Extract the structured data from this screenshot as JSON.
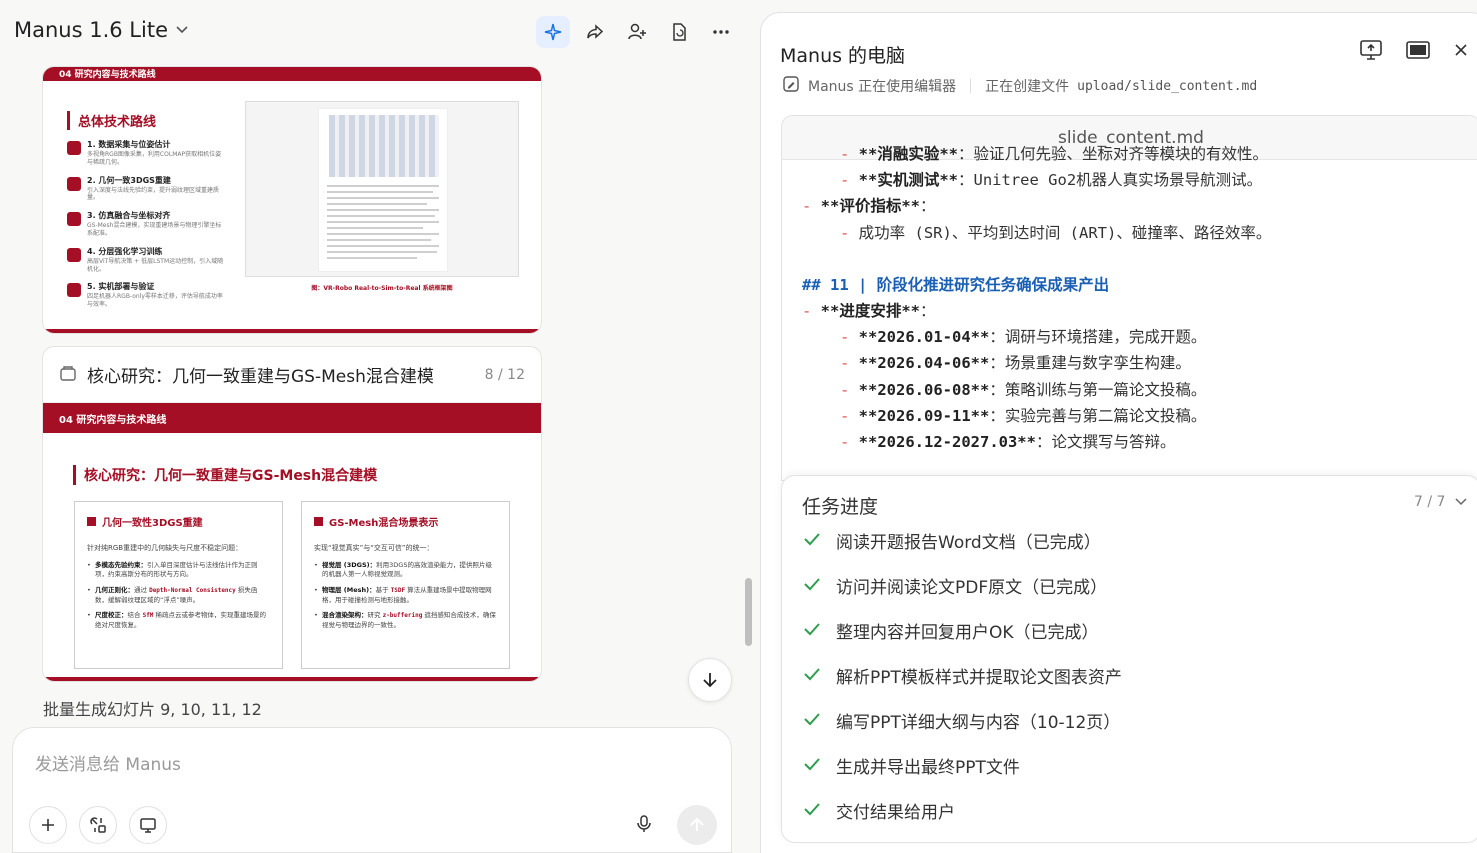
{
  "header": {
    "model_name": "Manus 1.6 Lite"
  },
  "slide_prev": {
    "section_label": "04 研究内容与技术路线",
    "title": "总体技术路线",
    "steps": [
      {
        "name": "1. 数据采集与位姿估计",
        "desc": "多视角RGB图像采集，利用COLMAP获取相机位姿与稀疏几何。"
      },
      {
        "name": "2. 几何一致3DGS重建",
        "desc": "引入深度与法线先验约束，提升弱纹理区域重建质量。"
      },
      {
        "name": "3. 仿真融合与坐标对齐",
        "desc": "GS-Mesh混合建模，实现重建场景与物理引擎坐标系配准。"
      },
      {
        "name": "4. 分层强化学习训练",
        "desc": "高层ViT导航决策 + 低层LSTM运动控制，引入域随机化。"
      },
      {
        "name": "5. 实机部署与验证",
        "desc": "四足机器人RGB-only零样本迁移，评估导航成功率与效率。"
      }
    ],
    "figure_caption": "图：VR-Robo Real-to-Sim-to-Real 系统框架图"
  },
  "slide_card": {
    "title": "核心研究：几何一致重建与GS-Mesh混合建模",
    "page": "8 / 12",
    "section_label": "04 研究内容与技术路线",
    "heading": "核心研究：几何一致重建与GS-Mesh混合建模",
    "box1": {
      "title": "几何一致性3DGS重建",
      "intro": "针对纯RGB重建中的几何缺失与尺度不稳定问题：",
      "items": [
        {
          "bold": "多模态先验约束：",
          "text": "引入单目深度估计与法线估计作为正则项，约束高斯分布的形状与方向。"
        },
        {
          "bold": "几何正则化：",
          "text": "通过 Depth-Normal Consistency 损失函数，缓解弱纹理区域的“浮点”噪声。"
        },
        {
          "bold": "尺度校正：",
          "text": "结合 SfM 稀疏点云或参考物体，实现重建场景的绝对尺度恢复。"
        }
      ]
    },
    "box2": {
      "title": "GS-Mesh混合场景表示",
      "intro": "实现“视觉真实”与“交互可信”的统一：",
      "items": [
        {
          "bold": "视觉层 (3DGS)：",
          "text": "利用3DGS的高效渲染能力，提供照片级的机器人第一人称视觉观测。"
        },
        {
          "bold": "物理层 (Mesh)：",
          "text": "基于 TSDF 算法从重建场景中提取物理网格，用于碰撞检测与地形接触。"
        },
        {
          "bold": "混合渲染架构：",
          "text": "研究 z-buffering 遮挡感知合成技术，确保视觉与物理边界的一致性。"
        }
      ]
    }
  },
  "batch_status": "批量生成幻灯片 9, 10, 11, 12",
  "composer": {
    "placeholder": "发送消息给 Manus"
  },
  "computer": {
    "title": "Manus 的电脑",
    "tool_status": "Manus 正在使用编辑器",
    "action": "正在创建文件",
    "file_path": "upload/slide_content.md"
  },
  "editor": {
    "filename": "slide_content.md",
    "lines": [
      {
        "indent": 2,
        "bold": "**消融实验**",
        "text": "：验证几何先验、坐标对齐等模块的有效性。"
      },
      {
        "indent": 2,
        "bold": "**实机测试**",
        "text": "：Unitree Go2机器人真实场景导航测试。"
      },
      {
        "indent": 1,
        "bold": "**评价指标**",
        "text": "："
      },
      {
        "indent": 2,
        "bold": "",
        "text": "成功率 (SR)、平均到达时间 (ART)、碰撞率、路径效率。"
      },
      {
        "indent": 0,
        "heading": "## 11 | 阶段化推进研究任务确保成果产出"
      },
      {
        "indent": 1,
        "bold": "**进度安排**",
        "text": "："
      },
      {
        "indent": 2,
        "bold": "**2026.01-04**",
        "text": "：调研与环境搭建，完成开题。"
      },
      {
        "indent": 2,
        "bold": "**2026.04-06**",
        "text": "：场景重建与数字孪生构建。"
      },
      {
        "indent": 2,
        "bold": "**2026.06-08**",
        "text": "：策略训练与第一篇论文投稿。"
      },
      {
        "indent": 2,
        "bold": "**2026.09-11**",
        "text": "：实验完善与第二篇论文投稿。"
      },
      {
        "indent": 2,
        "bold": "**2026.12-2027.03**",
        "text": "：论文撰写与答辩。"
      }
    ]
  },
  "tasks": {
    "title": "任务进度",
    "count": "7 / 7",
    "items": [
      "阅读开题报告Word文档（已完成）",
      "访问并阅读论文PDF原文（已完成）",
      "整理内容并回复用户OK（已完成）",
      "解析PPT模板样式并提取论文图表资产",
      "编写PPT详细大纲与内容（10-12页）",
      "生成并导出最终PPT文件",
      "交付结果给用户"
    ]
  },
  "colors": {
    "accent_red": "#a50f25",
    "check_green": "#2e9d4f",
    "heading_blue": "#1a5fb4",
    "active_icon_bg": "#e6efff"
  }
}
